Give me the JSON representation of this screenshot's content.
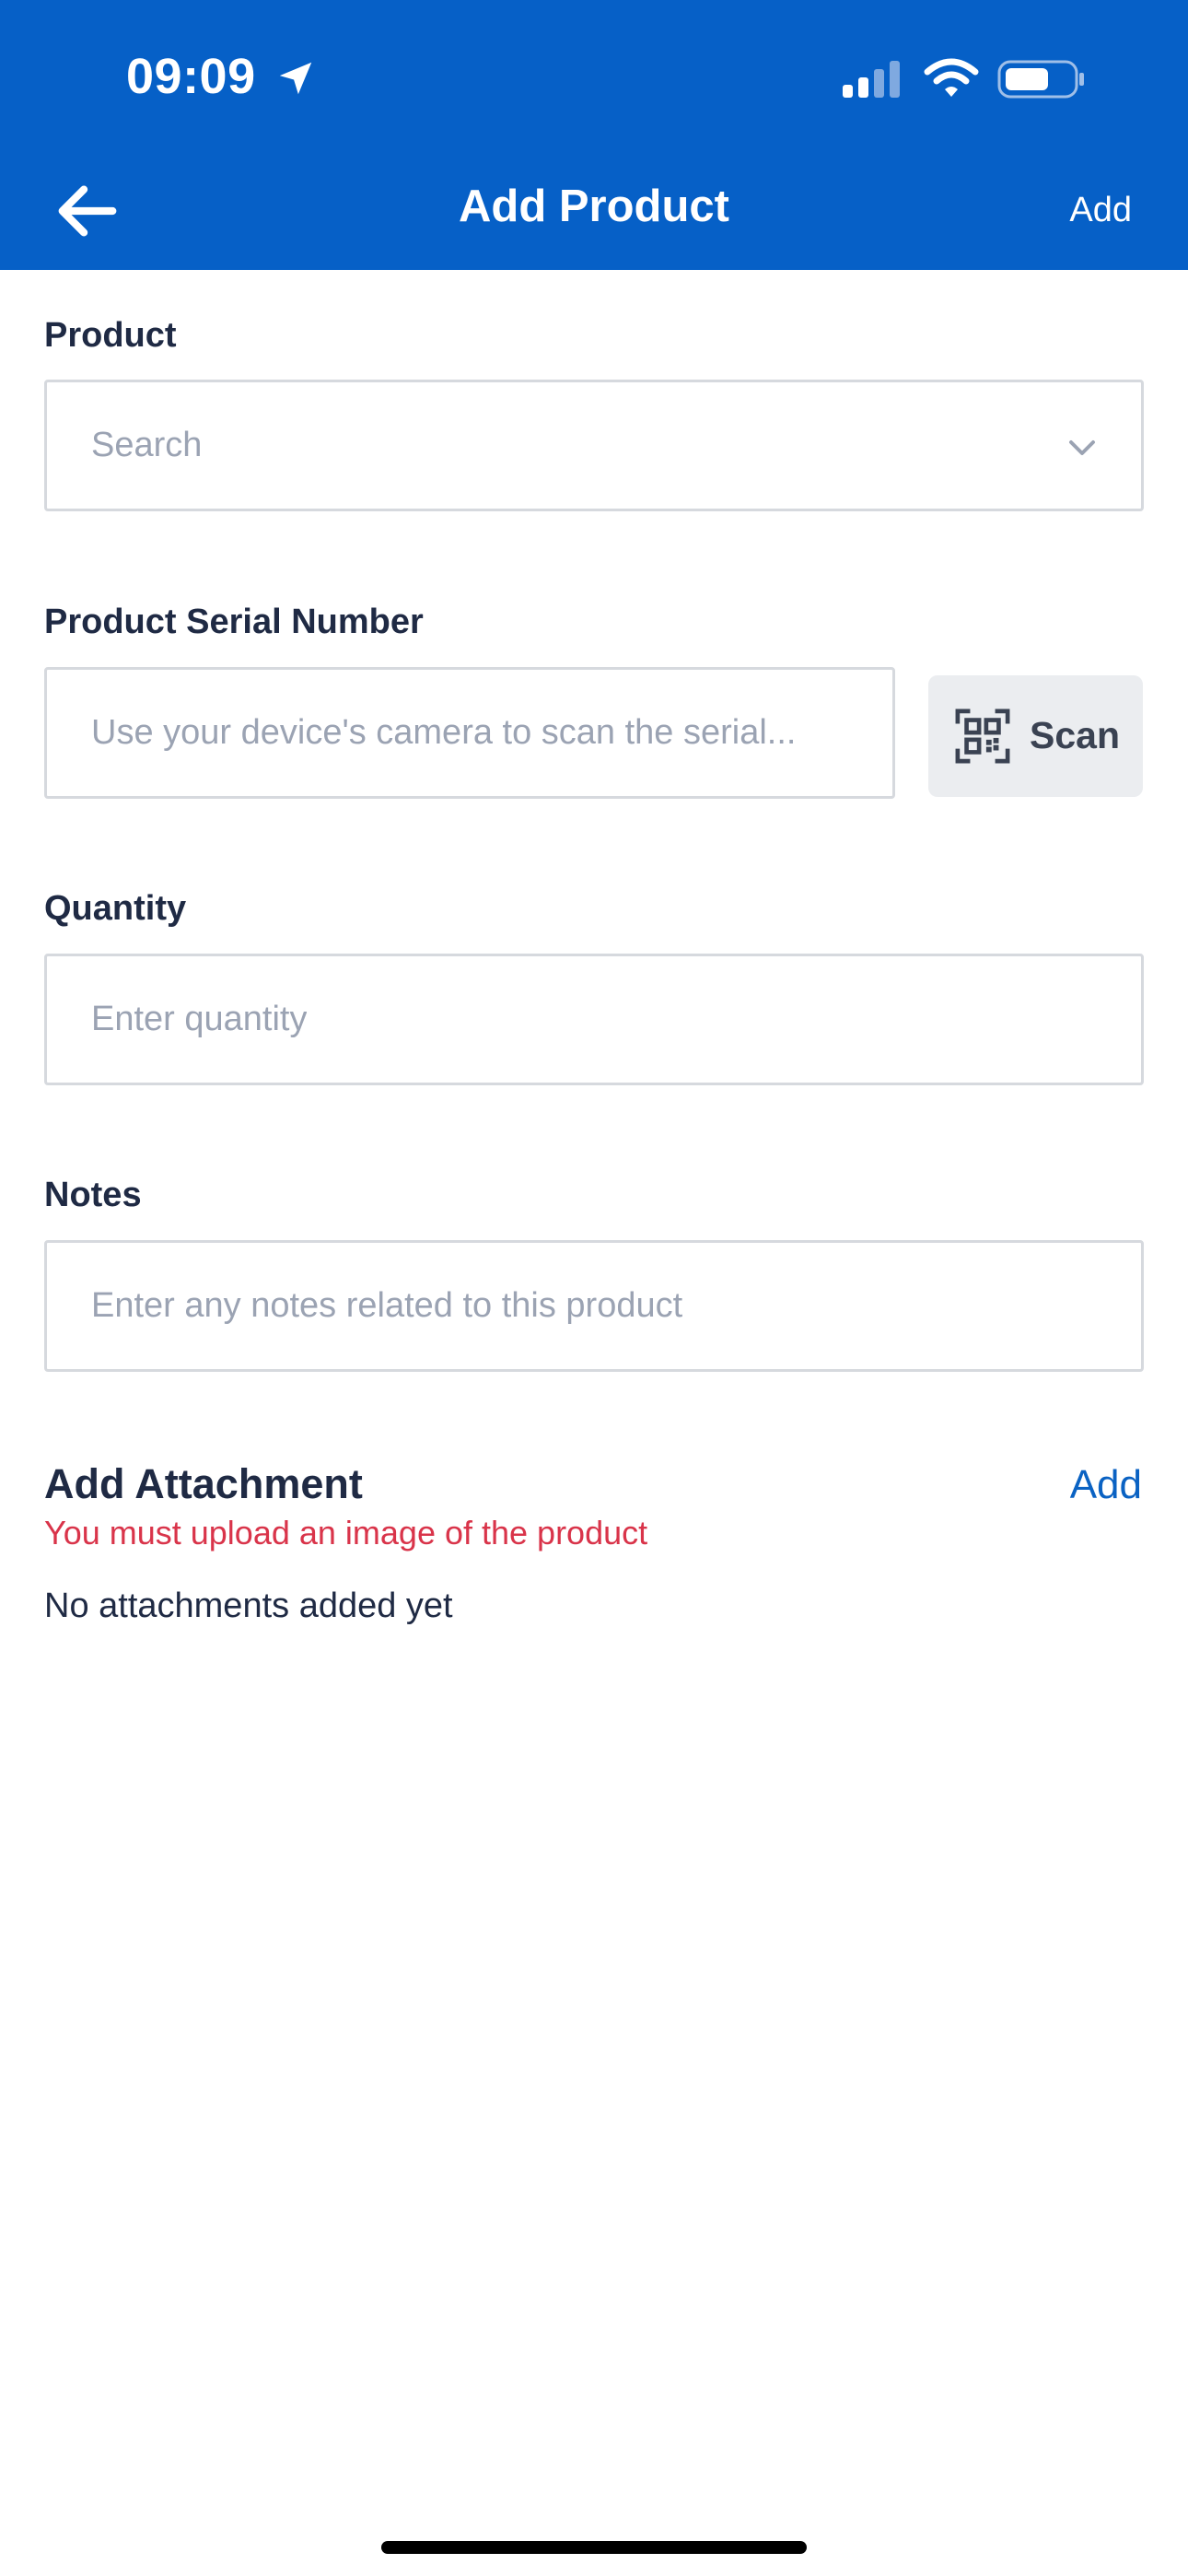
{
  "status_bar": {
    "time": "09:09",
    "icons": [
      "location-arrow-icon",
      "cellular-signal-icon",
      "wifi-icon",
      "battery-icon"
    ]
  },
  "nav": {
    "title": "Add Product",
    "add_label": "Add",
    "back_icon": "arrow-left-icon"
  },
  "form": {
    "product": {
      "label": "Product",
      "placeholder": "Search",
      "icon": "chevron-down-icon"
    },
    "serial": {
      "label": "Product Serial Number",
      "placeholder": "Use your device's camera to scan the serial...",
      "scan_label": "Scan",
      "scan_icon": "qr-code-icon"
    },
    "quantity": {
      "label": "Quantity",
      "placeholder": "Enter quantity"
    },
    "notes": {
      "label": "Notes",
      "placeholder": "Enter any notes related to this product"
    }
  },
  "attachments": {
    "title": "Add Attachment",
    "add_label": "Add",
    "error": "You must upload an image of the product",
    "empty_text": "No attachments added yet"
  },
  "colors": {
    "header_bg": "#0660c7",
    "accent": "#0a62c3",
    "error": "#d9344a"
  }
}
